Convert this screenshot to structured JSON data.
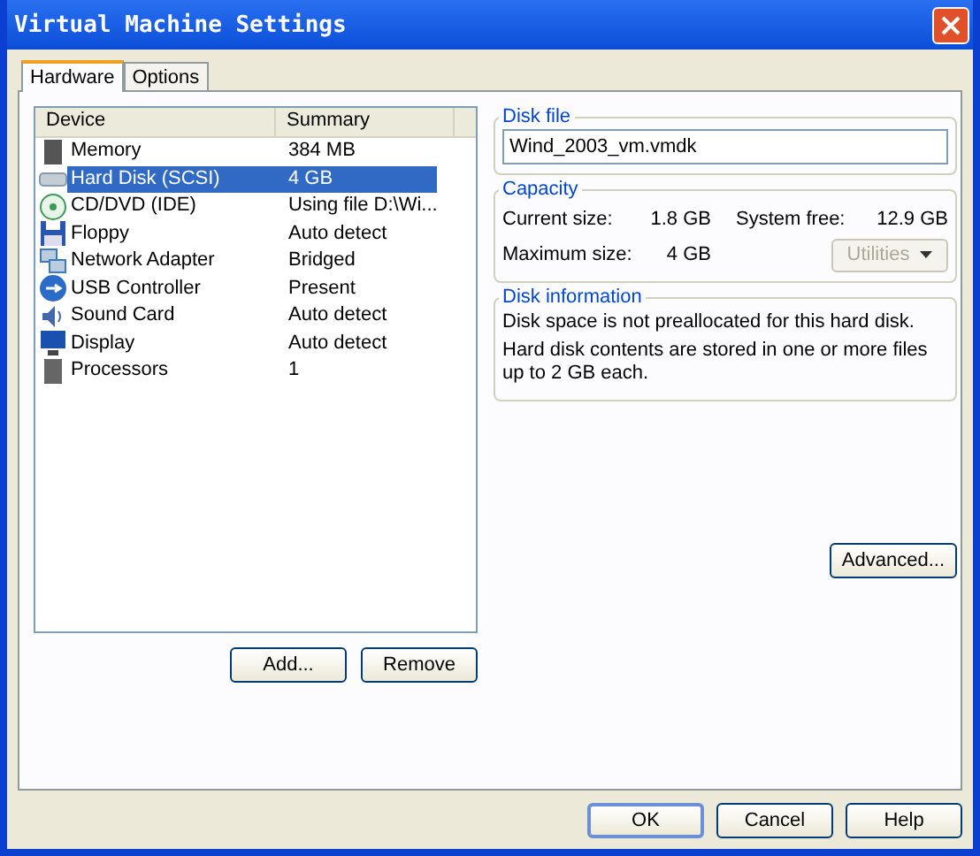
{
  "window": {
    "title": "Virtual Machine Settings"
  },
  "tabs": [
    {
      "label": "Hardware",
      "selected": true
    },
    {
      "label": "Options",
      "selected": false
    }
  ],
  "device_list": {
    "columns": [
      "Device",
      "Summary"
    ],
    "rows": [
      {
        "kind": "memory",
        "device": "Memory",
        "summary": "384 MB",
        "selected": false
      },
      {
        "kind": "disk",
        "device": "Hard Disk (SCSI)",
        "summary": "4 GB",
        "selected": true
      },
      {
        "kind": "cdrom",
        "device": "CD/DVD (IDE)",
        "summary": "Using file D:\\Wi...",
        "selected": false
      },
      {
        "kind": "floppy",
        "device": "Floppy",
        "summary": "Auto detect",
        "selected": false
      },
      {
        "kind": "network",
        "device": "Network Adapter",
        "summary": "Bridged",
        "selected": false
      },
      {
        "kind": "usb",
        "device": "USB Controller",
        "summary": "Present",
        "selected": false
      },
      {
        "kind": "sound",
        "device": "Sound Card",
        "summary": "Auto detect",
        "selected": false
      },
      {
        "kind": "display",
        "device": "Display",
        "summary": "Auto detect",
        "selected": false
      },
      {
        "kind": "cpu",
        "device": "Processors",
        "summary": "1",
        "selected": false
      }
    ]
  },
  "list_buttons": [
    "Add...",
    "Remove"
  ],
  "disk_file": {
    "title": "Disk file",
    "value": "Wind_2003_vm.vmdk"
  },
  "capacity": {
    "title": "Capacity",
    "current_label": "Current size:",
    "current_value": "1.8 GB",
    "free_label": "System free:",
    "free_value": "12.9 GB",
    "max_label": "Maximum size:",
    "max_value": "4 GB",
    "utilities": {
      "label": "Utilities",
      "disabled": true
    }
  },
  "disk_information": {
    "title": "Disk information",
    "lines": [
      "Disk space is not preallocated for this hard disk.",
      "Hard disk contents are stored in one or more files up to 2 GB each."
    ]
  },
  "advanced_button": "Advanced...",
  "dialog_buttons": [
    "OK",
    "Cancel",
    "Help"
  ]
}
